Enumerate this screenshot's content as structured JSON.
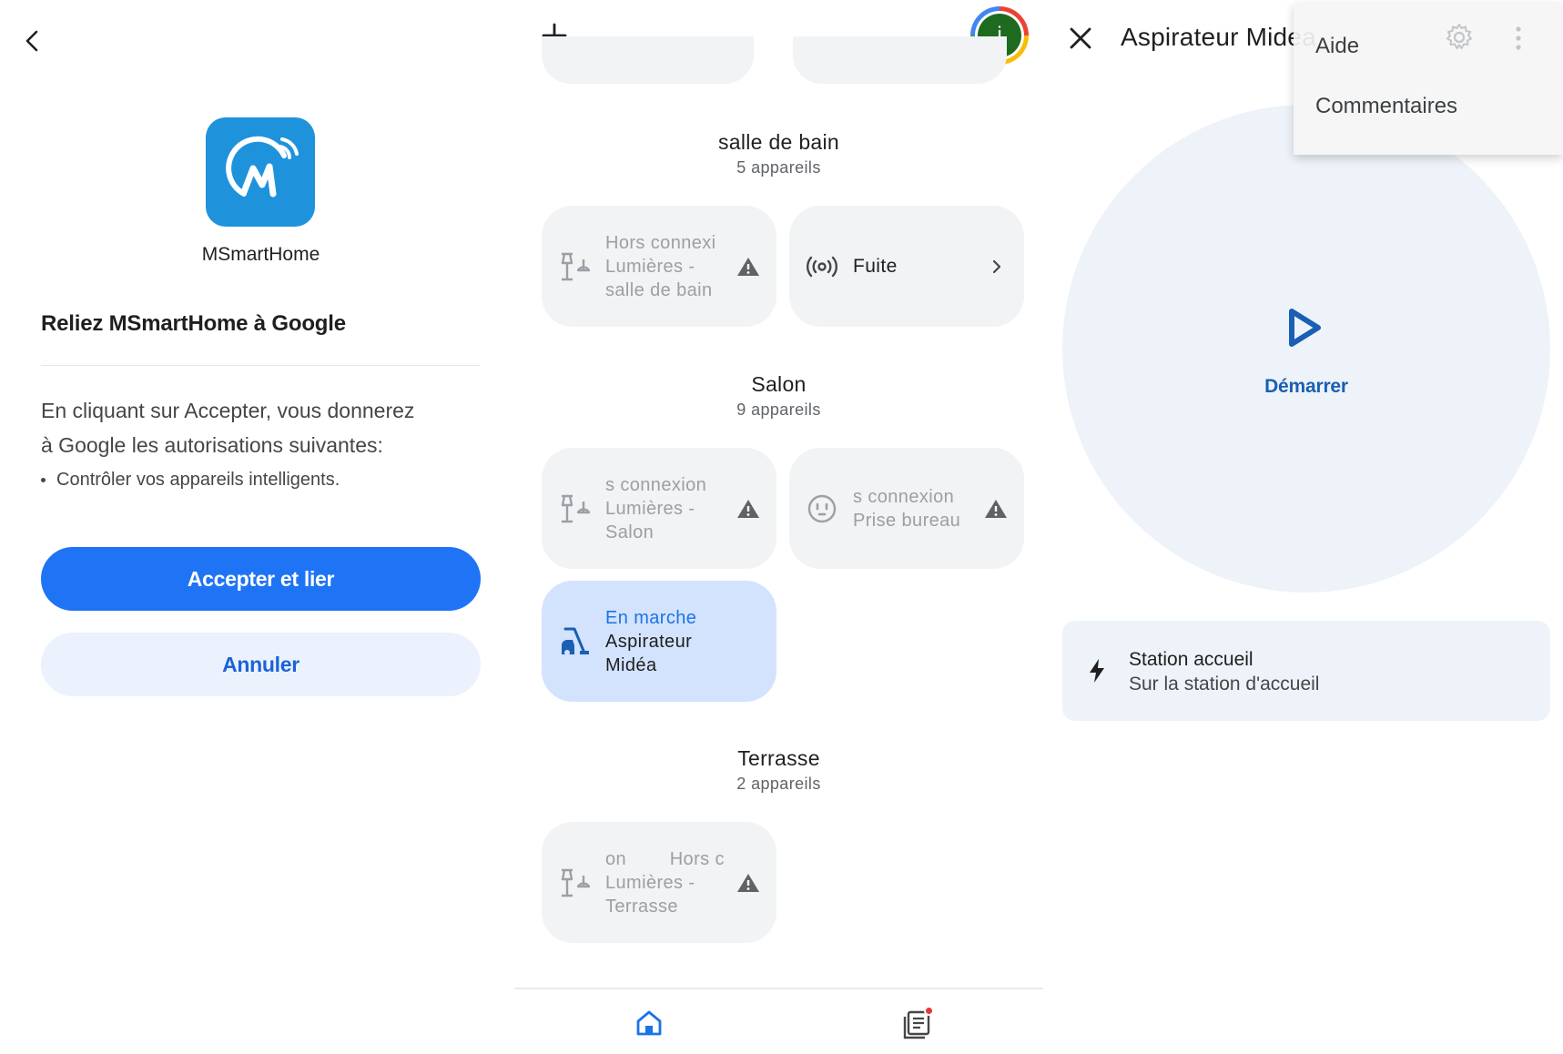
{
  "panel1": {
    "app_name": "MSmartHome",
    "link_title": "Reliez MSmartHome à Google",
    "consent_line1": "En cliquant sur Accepter, vous donnerez",
    "consent_line2": "à Google les autorisations suivantes:",
    "permission": "Contrôler vos appareils intelligents.",
    "accept_label": "Accepter et lier",
    "cancel_label": "Annuler",
    "icons": {
      "back": "chevron-left-icon",
      "logo": "msmarthome-logo-icon"
    },
    "colors": {
      "accent": "#1f73f5",
      "logo_bg": "#1e93dc"
    }
  },
  "panel2": {
    "avatar_initial": "j",
    "rooms": [
      {
        "name": "salle de bain",
        "count": "5 appareils",
        "tiles": [
          {
            "status": "Hors connexi",
            "name_line1": "Lumières -",
            "name_line2": "salle de bain",
            "icon": "lamp-icon",
            "warning": true
          },
          {
            "status": "",
            "name_line1": "Fuite",
            "name_line2": "",
            "icon": "leak-sensor-icon",
            "warning": false
          }
        ]
      },
      {
        "name": "Salon",
        "count": "9 appareils",
        "tiles": [
          {
            "status": "s connexion",
            "name_line1": "Lumières -",
            "name_line2": "Salon",
            "icon": "lamp-icon",
            "warning": true
          },
          {
            "status": "s connexion",
            "name_line1": "Prise bureau",
            "name_line2": "",
            "icon": "outlet-icon",
            "warning": true
          },
          {
            "status": "En marche",
            "name_line1": "Aspirateur",
            "name_line2": "Midéa",
            "icon": "vacuum-icon",
            "warning": false
          }
        ]
      },
      {
        "name": "Terrasse",
        "count": "2 appareils",
        "tiles": [
          {
            "status": "on        Hors c",
            "name_line1": "Lumières -",
            "name_line2": "Terrasse",
            "icon": "lamp-icon",
            "warning": true
          }
        ]
      }
    ],
    "colors": {
      "active_tile": "#d3e3fd",
      "tile": "#f1f3f4"
    }
  },
  "panel3": {
    "device_title": "Aspirateur Midea",
    "start_label": "Démarrer",
    "dock_title": "Station accueil",
    "dock_sub": "Sur la station d'accueil",
    "menu": [
      "Aide",
      "Commentaires"
    ],
    "colors": {
      "start": "#1a5fb4",
      "card": "#eef2f9"
    }
  }
}
